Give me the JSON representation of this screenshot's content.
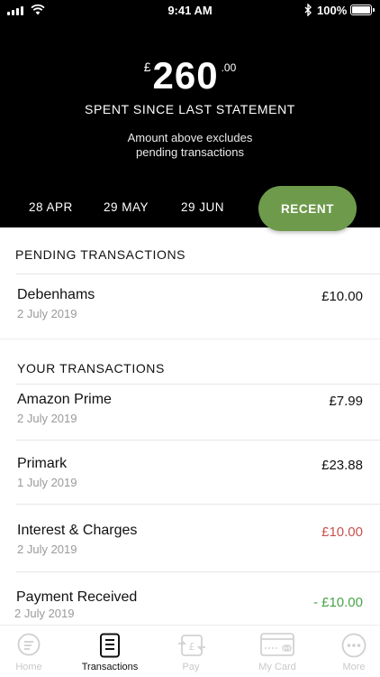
{
  "status_bar": {
    "time": "9:41 AM",
    "battery_percent": "100%",
    "icons": [
      "signal-icon",
      "wifi-icon",
      "bluetooth-icon",
      "battery-icon"
    ]
  },
  "balance": {
    "currency": "£",
    "whole": "260",
    "pence": ".00",
    "label": "SPENT SINCE LAST STATEMENT",
    "note_line1": "Amount above excludes",
    "note_line2": "pending transactions"
  },
  "periods": [
    {
      "label": "28 APR",
      "selected": false
    },
    {
      "label": "29 MAY",
      "selected": false
    },
    {
      "label": "29 JUN",
      "selected": false
    },
    {
      "label": "RECENT",
      "selected": true
    }
  ],
  "pending": {
    "title": "PENDING TRANSACTIONS",
    "items": [
      {
        "name": "Debenhams",
        "date": "2 July 2019",
        "amount": "£10.00",
        "tone": "normal"
      }
    ]
  },
  "transactions": {
    "title": "YOUR TRANSACTIONS",
    "items": [
      {
        "name": "Amazon Prime",
        "date": "2 July 2019",
        "amount": "£7.99",
        "tone": "normal"
      },
      {
        "name": "Primark",
        "date": "1 July 2019",
        "amount": "£23.88",
        "tone": "normal"
      },
      {
        "name": "Interest & Charges",
        "date": "2 July 2019",
        "amount": "£10.00",
        "tone": "red"
      },
      {
        "name": "Payment Received",
        "date": "2 July 2019",
        "amount": "- £10.00",
        "tone": "green"
      }
    ]
  },
  "tabs": [
    {
      "label": "Home",
      "icon": "home-icon",
      "active": false
    },
    {
      "label": "Transactions",
      "icon": "transactions-icon",
      "active": true
    },
    {
      "label": "Pay",
      "icon": "pay-icon",
      "active": false
    },
    {
      "label": "My Card",
      "icon": "card-icon",
      "active": false
    },
    {
      "label": "More",
      "icon": "more-icon",
      "active": false
    }
  ],
  "colors": {
    "header_bg": "#000000",
    "accent_green": "#6e9a4b",
    "negative_red": "#c9524f",
    "positive_green": "#49a34a"
  }
}
